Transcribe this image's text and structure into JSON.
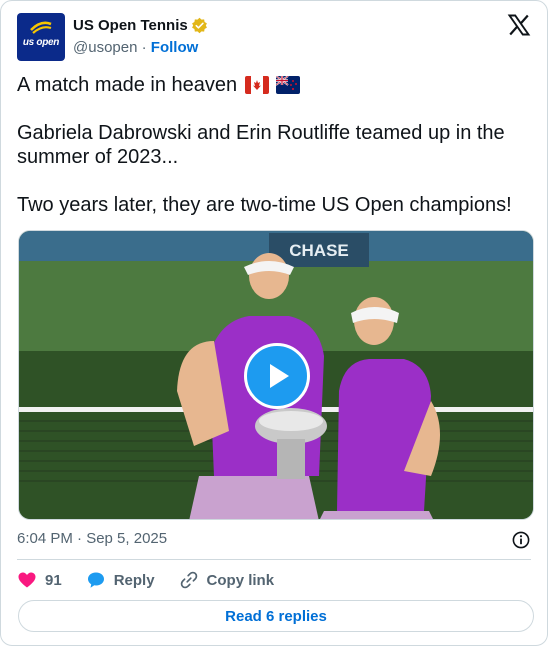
{
  "account": {
    "name": "US Open Tennis",
    "handle": "@usopen",
    "separator": "·",
    "follow_label": "Follow",
    "avatar_text": "us open"
  },
  "tweet": {
    "lines": [
      "A match made in heaven",
      "Gabriela Dabrowski and Erin Routliffe teamed up in the summer of 2023...",
      "Two years later, they are two-time US Open champions!"
    ],
    "flags": [
      "canada-flag-icon",
      "new-zealand-flag-icon"
    ]
  },
  "media": {
    "banner_text": "CHASE",
    "play_icon": "play-icon"
  },
  "meta": {
    "timestamp": "6:04 PM · Sep 5, 2025"
  },
  "actions": {
    "like_count": "91",
    "reply_label": "Reply",
    "copy_label": "Copy link"
  },
  "footer": {
    "read_replies_label": "Read 6 replies"
  },
  "colors": {
    "accent": "#1d9bf0",
    "link": "#006fd6",
    "heart": "#f91880",
    "avatar_bg": "#0b2a8a",
    "verified": "#e2b719"
  }
}
